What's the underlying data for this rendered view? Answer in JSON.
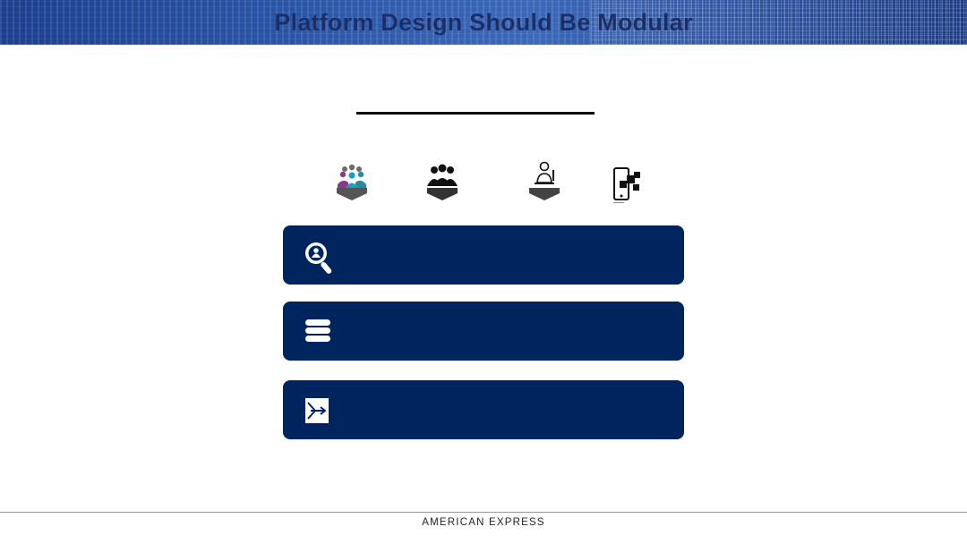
{
  "slide": {
    "title": "Platform Design Should Be Modular"
  },
  "personas": [
    {
      "icon": "colorful-group-icon"
    },
    {
      "icon": "group-icon"
    },
    {
      "icon": "developer-icon"
    },
    {
      "icon": "mobile-app-icon"
    }
  ],
  "panels": [
    {
      "icon": "user-search-icon"
    },
    {
      "icon": "database-icon"
    },
    {
      "icon": "merge-arrows-icon"
    }
  ],
  "footer": {
    "brand": "AMERICAN EXPRESS"
  },
  "colors": {
    "panel": "#00245e",
    "banner": "#2a55a6"
  }
}
